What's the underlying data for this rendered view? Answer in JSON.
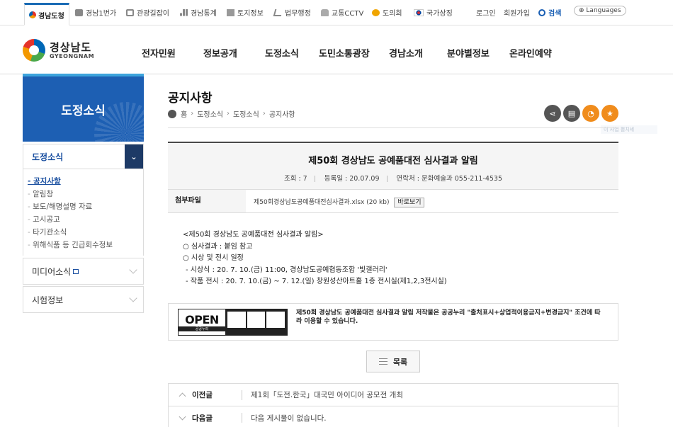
{
  "topbar": {
    "active_tab": "경남도청",
    "links": [
      "경남1번가",
      "관광길잡이",
      "경남통계",
      "토지정보",
      "법무행정",
      "교통CCTV",
      "도의회",
      "국가상징"
    ],
    "login": "로그인",
    "join": "회원가입",
    "search": "검색",
    "languages": "Languages"
  },
  "logo": {
    "ko": "경상남도",
    "en": "GYEONGNAM"
  },
  "gnb": [
    "전자민원",
    "정보공개",
    "도정소식",
    "도민소통광장",
    "경남소개",
    "분야별정보",
    "온라인예약"
  ],
  "sidebar": {
    "title": "도정소식",
    "section": "도정소식",
    "sub_items": [
      "공지사항",
      "알림창",
      "보도/해명설명 자료",
      "고시공고",
      "타기관소식",
      "위해식품 등 긴급회수정보"
    ],
    "items": [
      "미디어소식",
      "시험정보"
    ]
  },
  "page": {
    "title": "공지사항",
    "breadcrumb": [
      "홈",
      "도정소식",
      "도정소식",
      "공지사항"
    ],
    "tooltip": "이 사업 펼치세"
  },
  "post": {
    "title": "제50회 경상남도 공예품대전 심사결과 알림",
    "views": "조회 : 7",
    "date": "등록일 : 20.07.09",
    "contact": "연락처 : 문화예술과 055-211-4535",
    "attach_label": "첨부파일",
    "attach_file": "제50회경상남도공예품대전심사결과.xlsx (20 kb)",
    "view_btn": "바로보기",
    "body": [
      "<제50회 경상남도 공예품대전 심사결과 알림>",
      "○ 심사결과 : 붙임 참고",
      "○ 시상 및 전시 일정",
      " - 시상식 : 20. 7. 10.(금) 11:00, 경상남도공예협동조합 '빛갤러리'",
      " - 작품 전시 : 20. 7. 10.(금) ~ 7. 12.(일) 창원성산아트홀 1층 전시실(제1,2,3전시실)"
    ],
    "license_text": "제50회 경상남도 공예품대전 심사결과 알림 저작물은 공공누리 \"출처표시+상업적이용금지+변경금지\" 조건에 따라 이용할 수 있습니다.",
    "license_badge": "OPEN",
    "license_badge_sub": "공공누리"
  },
  "list_btn": "목록",
  "prev": {
    "label": "이전글",
    "title": "제1회「도전.한국」대국민 아이디어 공모전 개최"
  },
  "next": {
    "label": "다음글",
    "title": "다음 게시물이 없습니다."
  }
}
